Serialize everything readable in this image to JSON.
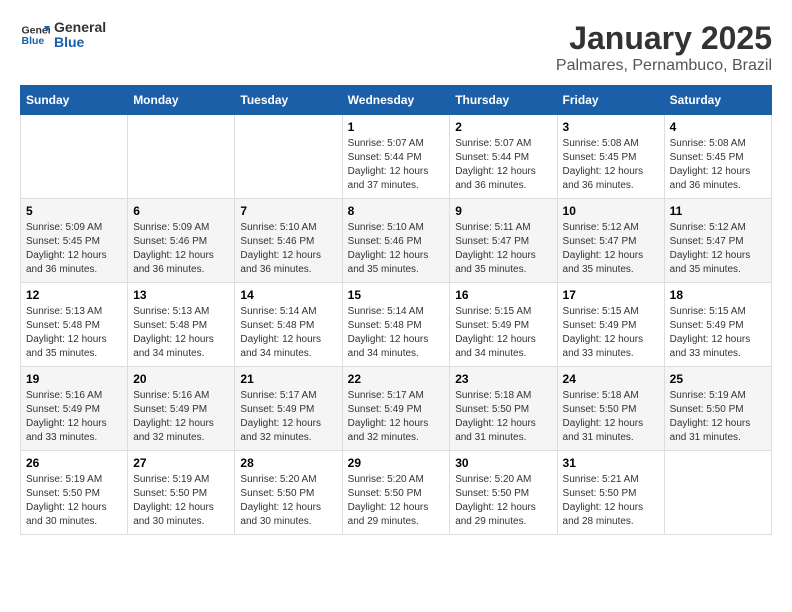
{
  "logo": {
    "line1": "General",
    "line2": "Blue"
  },
  "title": "January 2025",
  "subtitle": "Palmares, Pernambuco, Brazil",
  "weekdays": [
    "Sunday",
    "Monday",
    "Tuesday",
    "Wednesday",
    "Thursday",
    "Friday",
    "Saturday"
  ],
  "weeks": [
    [
      {
        "day": "",
        "sunrise": "",
        "sunset": "",
        "daylight": ""
      },
      {
        "day": "",
        "sunrise": "",
        "sunset": "",
        "daylight": ""
      },
      {
        "day": "",
        "sunrise": "",
        "sunset": "",
        "daylight": ""
      },
      {
        "day": "1",
        "sunrise": "Sunrise: 5:07 AM",
        "sunset": "Sunset: 5:44 PM",
        "daylight": "Daylight: 12 hours and 37 minutes."
      },
      {
        "day": "2",
        "sunrise": "Sunrise: 5:07 AM",
        "sunset": "Sunset: 5:44 PM",
        "daylight": "Daylight: 12 hours and 36 minutes."
      },
      {
        "day": "3",
        "sunrise": "Sunrise: 5:08 AM",
        "sunset": "Sunset: 5:45 PM",
        "daylight": "Daylight: 12 hours and 36 minutes."
      },
      {
        "day": "4",
        "sunrise": "Sunrise: 5:08 AM",
        "sunset": "Sunset: 5:45 PM",
        "daylight": "Daylight: 12 hours and 36 minutes."
      }
    ],
    [
      {
        "day": "5",
        "sunrise": "Sunrise: 5:09 AM",
        "sunset": "Sunset: 5:45 PM",
        "daylight": "Daylight: 12 hours and 36 minutes."
      },
      {
        "day": "6",
        "sunrise": "Sunrise: 5:09 AM",
        "sunset": "Sunset: 5:46 PM",
        "daylight": "Daylight: 12 hours and 36 minutes."
      },
      {
        "day": "7",
        "sunrise": "Sunrise: 5:10 AM",
        "sunset": "Sunset: 5:46 PM",
        "daylight": "Daylight: 12 hours and 36 minutes."
      },
      {
        "day": "8",
        "sunrise": "Sunrise: 5:10 AM",
        "sunset": "Sunset: 5:46 PM",
        "daylight": "Daylight: 12 hours and 35 minutes."
      },
      {
        "day": "9",
        "sunrise": "Sunrise: 5:11 AM",
        "sunset": "Sunset: 5:47 PM",
        "daylight": "Daylight: 12 hours and 35 minutes."
      },
      {
        "day": "10",
        "sunrise": "Sunrise: 5:12 AM",
        "sunset": "Sunset: 5:47 PM",
        "daylight": "Daylight: 12 hours and 35 minutes."
      },
      {
        "day": "11",
        "sunrise": "Sunrise: 5:12 AM",
        "sunset": "Sunset: 5:47 PM",
        "daylight": "Daylight: 12 hours and 35 minutes."
      }
    ],
    [
      {
        "day": "12",
        "sunrise": "Sunrise: 5:13 AM",
        "sunset": "Sunset: 5:48 PM",
        "daylight": "Daylight: 12 hours and 35 minutes."
      },
      {
        "day": "13",
        "sunrise": "Sunrise: 5:13 AM",
        "sunset": "Sunset: 5:48 PM",
        "daylight": "Daylight: 12 hours and 34 minutes."
      },
      {
        "day": "14",
        "sunrise": "Sunrise: 5:14 AM",
        "sunset": "Sunset: 5:48 PM",
        "daylight": "Daylight: 12 hours and 34 minutes."
      },
      {
        "day": "15",
        "sunrise": "Sunrise: 5:14 AM",
        "sunset": "Sunset: 5:48 PM",
        "daylight": "Daylight: 12 hours and 34 minutes."
      },
      {
        "day": "16",
        "sunrise": "Sunrise: 5:15 AM",
        "sunset": "Sunset: 5:49 PM",
        "daylight": "Daylight: 12 hours and 34 minutes."
      },
      {
        "day": "17",
        "sunrise": "Sunrise: 5:15 AM",
        "sunset": "Sunset: 5:49 PM",
        "daylight": "Daylight: 12 hours and 33 minutes."
      },
      {
        "day": "18",
        "sunrise": "Sunrise: 5:15 AM",
        "sunset": "Sunset: 5:49 PM",
        "daylight": "Daylight: 12 hours and 33 minutes."
      }
    ],
    [
      {
        "day": "19",
        "sunrise": "Sunrise: 5:16 AM",
        "sunset": "Sunset: 5:49 PM",
        "daylight": "Daylight: 12 hours and 33 minutes."
      },
      {
        "day": "20",
        "sunrise": "Sunrise: 5:16 AM",
        "sunset": "Sunset: 5:49 PM",
        "daylight": "Daylight: 12 hours and 32 minutes."
      },
      {
        "day": "21",
        "sunrise": "Sunrise: 5:17 AM",
        "sunset": "Sunset: 5:49 PM",
        "daylight": "Daylight: 12 hours and 32 minutes."
      },
      {
        "day": "22",
        "sunrise": "Sunrise: 5:17 AM",
        "sunset": "Sunset: 5:49 PM",
        "daylight": "Daylight: 12 hours and 32 minutes."
      },
      {
        "day": "23",
        "sunrise": "Sunrise: 5:18 AM",
        "sunset": "Sunset: 5:50 PM",
        "daylight": "Daylight: 12 hours and 31 minutes."
      },
      {
        "day": "24",
        "sunrise": "Sunrise: 5:18 AM",
        "sunset": "Sunset: 5:50 PM",
        "daylight": "Daylight: 12 hours and 31 minutes."
      },
      {
        "day": "25",
        "sunrise": "Sunrise: 5:19 AM",
        "sunset": "Sunset: 5:50 PM",
        "daylight": "Daylight: 12 hours and 31 minutes."
      }
    ],
    [
      {
        "day": "26",
        "sunrise": "Sunrise: 5:19 AM",
        "sunset": "Sunset: 5:50 PM",
        "daylight": "Daylight: 12 hours and 30 minutes."
      },
      {
        "day": "27",
        "sunrise": "Sunrise: 5:19 AM",
        "sunset": "Sunset: 5:50 PM",
        "daylight": "Daylight: 12 hours and 30 minutes."
      },
      {
        "day": "28",
        "sunrise": "Sunrise: 5:20 AM",
        "sunset": "Sunset: 5:50 PM",
        "daylight": "Daylight: 12 hours and 30 minutes."
      },
      {
        "day": "29",
        "sunrise": "Sunrise: 5:20 AM",
        "sunset": "Sunset: 5:50 PM",
        "daylight": "Daylight: 12 hours and 29 minutes."
      },
      {
        "day": "30",
        "sunrise": "Sunrise: 5:20 AM",
        "sunset": "Sunset: 5:50 PM",
        "daylight": "Daylight: 12 hours and 29 minutes."
      },
      {
        "day": "31",
        "sunrise": "Sunrise: 5:21 AM",
        "sunset": "Sunset: 5:50 PM",
        "daylight": "Daylight: 12 hours and 28 minutes."
      },
      {
        "day": "",
        "sunrise": "",
        "sunset": "",
        "daylight": ""
      }
    ]
  ]
}
